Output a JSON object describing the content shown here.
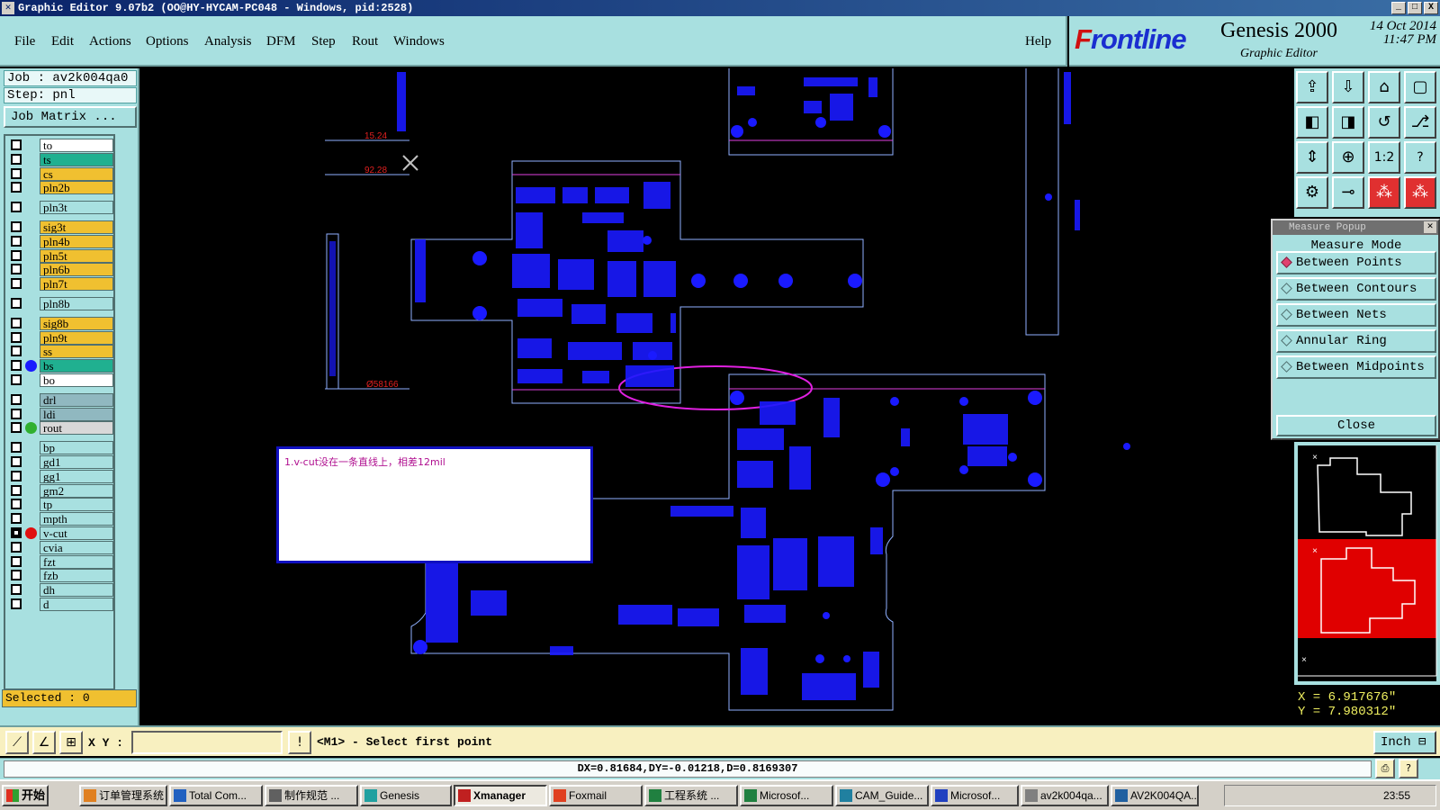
{
  "window": {
    "title": "Graphic Editor 9.07b2 (OO@HY-HYCAM-PC048 - Windows, pid:2528)",
    "controls": [
      "_",
      "□",
      "X"
    ]
  },
  "menu": {
    "items": [
      "File",
      "Edit",
      "Actions",
      "Options",
      "Analysis",
      "DFM",
      "Step",
      "Rout",
      "Windows"
    ],
    "help": "Help"
  },
  "brand": {
    "logo_first": "F",
    "logo_rest": "rontline",
    "product": "Genesis 2000",
    "subtitle": "Graphic Editor",
    "date": "14 Oct 2014",
    "time": "11:47 PM"
  },
  "job": {
    "job_label": "Job : av2k004qa0",
    "step_label": "Step: pnl",
    "matrix_button": "Job Matrix ..."
  },
  "layers": [
    {
      "name": "to",
      "color": "white",
      "on": false,
      "dot": ""
    },
    {
      "name": "ts",
      "color": "green",
      "on": false,
      "dot": ""
    },
    {
      "name": "cs",
      "color": "orange",
      "on": false,
      "dot": ""
    },
    {
      "name": "pln2b",
      "color": "orange",
      "on": false,
      "dot": ""
    },
    {
      "name": "pln3t",
      "color": "cyan",
      "on": false,
      "dot": ""
    },
    {
      "name": "sig3t",
      "color": "orange",
      "on": false,
      "dot": ""
    },
    {
      "name": "pln4b",
      "color": "orange",
      "on": false,
      "dot": ""
    },
    {
      "name": "pln5t",
      "color": "orange",
      "on": false,
      "dot": ""
    },
    {
      "name": "pln6b",
      "color": "orange",
      "on": false,
      "dot": ""
    },
    {
      "name": "pln7t",
      "color": "orange",
      "on": false,
      "dot": ""
    },
    {
      "name": "pln8b",
      "color": "cyan",
      "on": false,
      "dot": ""
    },
    {
      "name": "sig8b",
      "color": "orange",
      "on": false,
      "dot": ""
    },
    {
      "name": "pln9t",
      "color": "orange",
      "on": false,
      "dot": ""
    },
    {
      "name": "ss",
      "color": "orange",
      "on": false,
      "dot": ""
    },
    {
      "name": "bs",
      "color": "green",
      "on": false,
      "dot": "#1a1aff"
    },
    {
      "name": "bo",
      "color": "white",
      "on": false,
      "dot": ""
    },
    {
      "name": "drl",
      "color": "slate",
      "on": false,
      "dot": ""
    },
    {
      "name": "ldi",
      "color": "slate",
      "on": false,
      "dot": ""
    },
    {
      "name": "rout",
      "color": "gray",
      "on": false,
      "dot": "#30b030"
    },
    {
      "name": "bp",
      "color": "cyan",
      "on": false,
      "dot": ""
    },
    {
      "name": "gd1",
      "color": "cyan",
      "on": false,
      "dot": ""
    },
    {
      "name": "gg1",
      "color": "cyan",
      "on": false,
      "dot": ""
    },
    {
      "name": "gm2",
      "color": "cyan",
      "on": false,
      "dot": ""
    },
    {
      "name": "tp",
      "color": "cyan",
      "on": false,
      "dot": ""
    },
    {
      "name": "mpth",
      "color": "cyan",
      "on": false,
      "dot": ""
    },
    {
      "name": "v-cut",
      "color": "cyan",
      "on": true,
      "dot": "#e01010"
    },
    {
      "name": "cvia",
      "color": "cyan",
      "on": false,
      "dot": ""
    },
    {
      "name": "fzt",
      "color": "cyan",
      "on": false,
      "dot": ""
    },
    {
      "name": "fzb",
      "color": "cyan",
      "on": false,
      "dot": ""
    },
    {
      "name": "dh",
      "color": "cyan",
      "on": false,
      "dot": ""
    },
    {
      "name": "d",
      "color": "cyan",
      "on": false,
      "dot": ""
    }
  ],
  "selected_label": "Selected : 0",
  "toolbar_icons": [
    "export-icon",
    "import-icon",
    "home-icon",
    "window-icon",
    "pan-left-icon",
    "pan-right-icon",
    "pan-reset-icon",
    "snap-icon",
    "zoom-fit-icon",
    "zoom-center-icon",
    "scale-1-2-icon",
    "help-icon",
    "profile-icon",
    "stub-icon",
    "net-highlight-icon",
    "net-select-icon"
  ],
  "toolbar_glyphs": {
    "scale": "1:2",
    "help": "?"
  },
  "measure_popup": {
    "title": "Measure Popup",
    "heading": "Measure Mode",
    "options": [
      "Between Points",
      "Between Contours",
      "Between Nets",
      "Annular Ring",
      "Between Midpoints"
    ],
    "selected_index": 0,
    "close_label": "Close"
  },
  "coords": {
    "x": "X = 6.917676\"",
    "y": "Y = 7.980312\""
  },
  "command_bar": {
    "xy_label": "X Y :",
    "xy_value": "",
    "prompt": "<M1> - Select first point",
    "unit": "Inch"
  },
  "status": "DX=0.81684,DY=-0.01218,D=0.8169307",
  "canvas_text": {
    "dim1": "15.24",
    "dim2": "92.28",
    "dim3": "Ø58166",
    "note": "1.v-cut没在一条直线上，相差12mil"
  },
  "taskbar": {
    "start": "开始",
    "tasks": [
      {
        "label": "订单管理系统",
        "icon_color": "#e08020",
        "active": false
      },
      {
        "label": "Total Com...",
        "icon_color": "#2060c0",
        "active": false
      },
      {
        "label": "制作规范 ...",
        "icon_color": "#606060",
        "active": false
      },
      {
        "label": "Genesis",
        "icon_color": "#20a0a0",
        "active": false
      },
      {
        "label": "Xmanager",
        "icon_color": "#c02020",
        "active": true
      },
      {
        "label": "Foxmail",
        "icon_color": "#e04020",
        "active": false
      },
      {
        "label": "工程系统 ...",
        "icon_color": "#208040",
        "active": false
      },
      {
        "label": "Microsof...",
        "icon_color": "#208040",
        "active": false
      },
      {
        "label": "CAM_Guide...",
        "icon_color": "#2080a0",
        "active": false
      },
      {
        "label": "Microsof...",
        "icon_color": "#2040c0",
        "active": false
      },
      {
        "label": "av2k004qa...",
        "icon_color": "#808080",
        "active": false
      },
      {
        "label": "AV2K004QA...",
        "icon_color": "#2060a0",
        "active": false
      }
    ],
    "clock": "23:55"
  }
}
